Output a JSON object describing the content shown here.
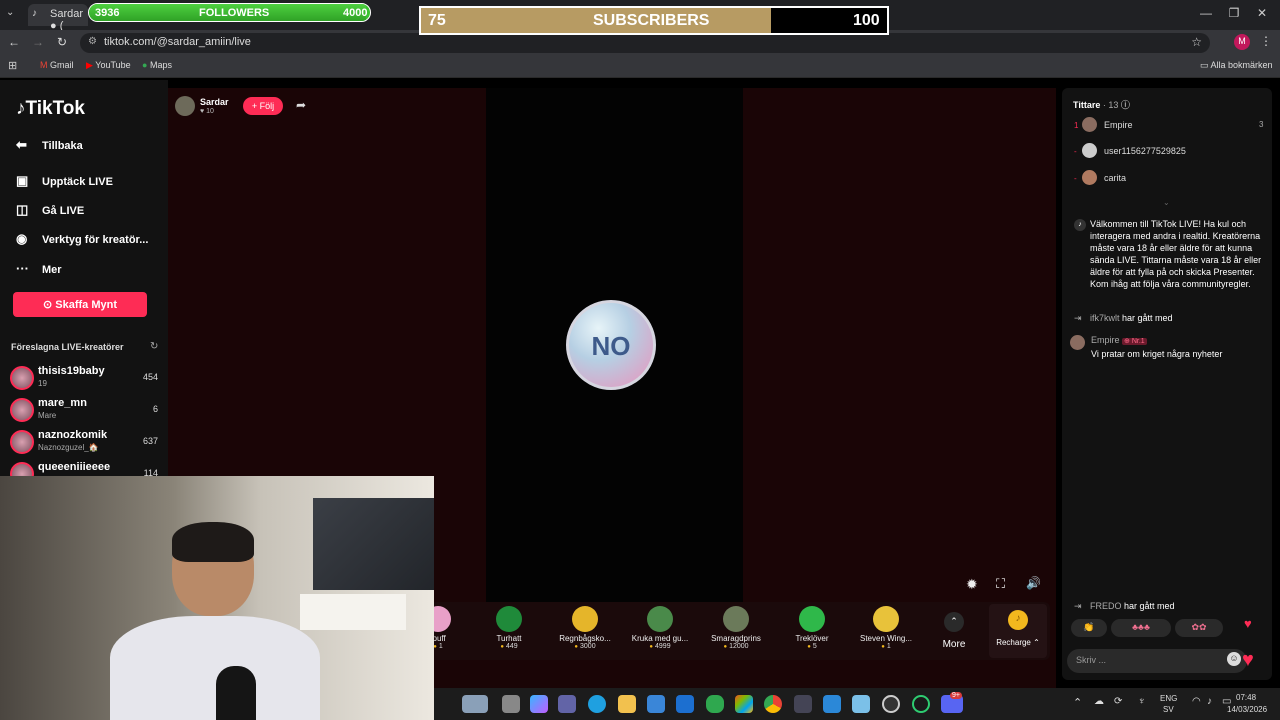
{
  "browser": {
    "tab_title": "Sardar ● (",
    "url": "tiktok.com/@sardar_amiin/live",
    "bookmarks": [
      "Gmail",
      "YouTube",
      "Maps"
    ],
    "all_bookmarks": "Alla bokmärken",
    "profile_initial": "M"
  },
  "overlay": {
    "followers": {
      "current": "3936",
      "label": "FOLLOWERS",
      "goal": "4000",
      "progress": 0.984
    },
    "subscribers": {
      "current": "75",
      "label": "SUBSCRIBERS",
      "goal": "100",
      "progress": 0.75
    }
  },
  "sidebar": {
    "logo": "TikTok",
    "back": "Tillbaka",
    "nav": [
      "Upptäck LIVE",
      "Gå LIVE",
      "Verktyg för kreatör...",
      "Mer"
    ],
    "coins_button": "Skaffa Mynt",
    "suggested_title": "Föreslagna LIVE-kreatörer",
    "creators": [
      {
        "name": "thisis19baby",
        "sub": "19",
        "count": "454"
      },
      {
        "name": "mare_mn",
        "sub": "Mare",
        "count": "6"
      },
      {
        "name": "naznozkomik",
        "sub": "Naznozguzel_🏠",
        "count": "637"
      },
      {
        "name": "queeeniiieeee",
        "sub": "",
        "count": "114"
      }
    ]
  },
  "stream": {
    "host_name": "Sardar",
    "host_likes": "10",
    "follow_button": "+ Följ",
    "center_badge": "NO"
  },
  "gifts": [
    {
      "name": "tpuff",
      "price": "1"
    },
    {
      "name": "Turhatt",
      "price": "449"
    },
    {
      "name": "Regnbågsko...",
      "price": "3000"
    },
    {
      "name": "Kruka med gu...",
      "price": "4999"
    },
    {
      "name": "Smaragdprins",
      "price": "12000"
    },
    {
      "name": "Treklöver",
      "price": "5"
    },
    {
      "name": "Steven Wing...",
      "price": "1"
    }
  ],
  "gift_more": "More",
  "recharge": "Recharge",
  "chat": {
    "viewers_title": "Tittare",
    "viewers_count": "13",
    "viewers": [
      {
        "rank": "1",
        "name": "Empire",
        "score": "3"
      },
      {
        "rank": "-",
        "name": "user1156277529825",
        "score": ""
      },
      {
        "rank": "-",
        "name": "carita",
        "score": ""
      }
    ],
    "welcome": "Välkommen till TikTok LIVE! Ha kul och interagera med andra i realtid. Kreatörerna måste vara 18 år eller äldre för att kunna sända LIVE. Tittarna måste vara 18 år eller äldre för att fylla på och skicka Presenter. Kom ihåg att följa våra communityregler.",
    "events": [
      {
        "user": "ifk7kwlt",
        "text": "har gått med"
      }
    ],
    "message": {
      "user": "Empire",
      "badge": "Nr.1",
      "text": "Vi pratar om kriget några nyheter"
    },
    "join_footer": {
      "user": "FREDO",
      "text": "har gått med"
    },
    "input_placeholder": "Skriv ..."
  },
  "taskbar": {
    "lang_top": "ENG",
    "lang_bottom": "SV",
    "time": "07:48",
    "date": "14/03/2026",
    "badge": "9+"
  }
}
